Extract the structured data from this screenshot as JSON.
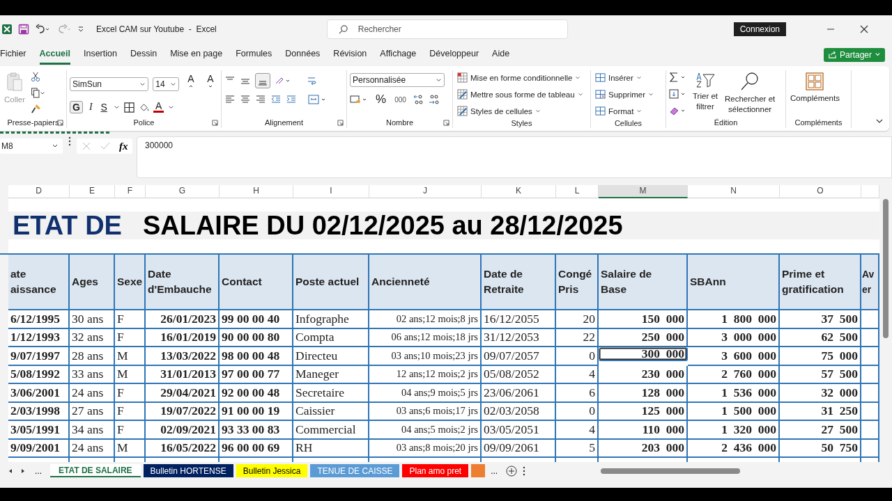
{
  "title_bar": {
    "document_title": "Excel CAM sur Youtube  -  Excel",
    "search_placeholder": "Rechercher",
    "signin_button": "Connexion",
    "share_button": "Partager"
  },
  "menu_tabs": [
    {
      "label": "Fichier",
      "selected": false
    },
    {
      "label": "Accueil",
      "selected": true
    },
    {
      "label": "Insertion",
      "selected": false
    },
    {
      "label": "Dessin",
      "selected": false
    },
    {
      "label": "Mise en page",
      "selected": false
    },
    {
      "label": "Formules",
      "selected": false
    },
    {
      "label": "Données",
      "selected": false
    },
    {
      "label": "Révision",
      "selected": false
    },
    {
      "label": "Affichage",
      "selected": false
    },
    {
      "label": "Développeur",
      "selected": false
    },
    {
      "label": "Aide",
      "selected": false
    }
  ],
  "ribbon": {
    "clipboard": {
      "paste": "Coller",
      "label": "Presse-papiers"
    },
    "font": {
      "name": "SimSun",
      "size": "14",
      "grow": "A",
      "shrink": "A",
      "bold": "G",
      "italic": "I",
      "underline": "S",
      "color_letter": "A",
      "label": "Police"
    },
    "alignment": {
      "label": "Alignement"
    },
    "number": {
      "format": "Personnalisée",
      "percent": "%",
      "thousands": "000",
      "label": "Nombre"
    },
    "styles": {
      "items": [
        "Mise en forme conditionnelle",
        "Mettre sous forme de tableau",
        "Styles de cellules"
      ],
      "label": "Styles"
    },
    "cells": {
      "items": [
        "Insérer",
        "Supprimer",
        "Format"
      ],
      "label": "Cellules"
    },
    "editing": {
      "sort": "Trier et\nfiltrer",
      "find": "Rechercher et\nsélectionner",
      "label": "Édition"
    },
    "addins": {
      "button": "Compléments",
      "label": "Compléments"
    }
  },
  "formula_bar": {
    "name_box": "M8",
    "fx": "fx",
    "value": "300000"
  },
  "sheet": {
    "columns": [
      {
        "letter": "D",
        "selected": false
      },
      {
        "letter": "E",
        "selected": false
      },
      {
        "letter": "F",
        "selected": false
      },
      {
        "letter": "G",
        "selected": false
      },
      {
        "letter": "H",
        "selected": false
      },
      {
        "letter": "I",
        "selected": false
      },
      {
        "letter": "J",
        "selected": false
      },
      {
        "letter": "K",
        "selected": false
      },
      {
        "letter": "L",
        "selected": false
      },
      {
        "letter": "M",
        "selected": true
      },
      {
        "letter": "N",
        "selected": false
      },
      {
        "letter": "O",
        "selected": false
      }
    ],
    "title_part_1": "ETAT DE",
    "title_part_2": "SALAIRE DU 02/12/2025 au 28/12/2025",
    "headers": [
      "ate\naissance",
      "Ages",
      "Sexe",
      "Date\nd'Embauche",
      "Contact",
      "Poste actuel",
      "Ancienneté",
      "Date de\nRetraite",
      "Congé\nPris",
      "Salaire de\nBase",
      "SBAnn",
      "Prime et\ngratification",
      "Av\ner"
    ],
    "rows": [
      {
        "selected": false,
        "cells": [
          "6/12/1995",
          "30 ans",
          "F",
          "26/01/2023",
          "99 00 00 40",
          "Infographe",
          "02 ans;12 mois;8 jrs",
          "16/12/2055",
          "20",
          "150  000",
          "1  800  000",
          "37  500"
        ]
      },
      {
        "selected": false,
        "cells": [
          "1/12/1993",
          "32 ans",
          "F",
          "16/01/2019",
          "90 00 00 80",
          "Compta",
          "06 ans;12 mois;18 jrs",
          "31/12/2053",
          "22",
          "250  000",
          "3  000  000",
          "62  500"
        ]
      },
      {
        "selected": true,
        "cells": [
          "9/07/1997",
          "28 ans",
          "M",
          "13/03/2022",
          "98 00 00 48",
          "Directeu",
          "03 ans;10 mois;23 jrs",
          "09/07/2057",
          "0",
          "300  000",
          "3  600  000",
          "75  000"
        ]
      },
      {
        "selected": false,
        "cells": [
          "5/08/1992",
          "33 ans",
          "M",
          "31/01/2013",
          "97 00 00 77",
          "Maneger",
          "12 ans;12 mois;2 jrs",
          "05/08/2052",
          "4",
          "230  000",
          "2  760  000",
          "57  500"
        ]
      },
      {
        "selected": false,
        "cells": [
          "3/06/2001",
          "24 ans",
          "F",
          "29/04/2021",
          "92 00 00 48",
          "Secretaire",
          "04 ans;9 mois;5 jrs",
          "23/06/2061",
          "6",
          "128  000",
          "1  536  000",
          "32  000"
        ]
      },
      {
        "selected": false,
        "cells": [
          "2/03/1998",
          "27 ans",
          "F",
          "19/07/2022",
          "91 00 00 19",
          "Caissier",
          "03 ans;6 mois;17 jrs",
          "02/03/2058",
          "0",
          "125  000",
          "1  500  000",
          "31  250"
        ]
      },
      {
        "selected": false,
        "cells": [
          "3/05/1991",
          "34 ans",
          "F",
          "02/09/2021",
          "93 33 00 83",
          "Commercial",
          "04 ans;5 mois;2 jrs",
          "03/05/2051",
          "4",
          "110  000",
          "1  320  000",
          "27  500"
        ]
      },
      {
        "selected": false,
        "cells": [
          "9/09/2001",
          "24 ans",
          "M",
          "16/05/2022",
          "96 00 00 69",
          "RH",
          "03 ans;8 mois;20 jrs",
          "09/09/2061",
          "5",
          "203  000",
          "2  436  000",
          "50  750"
        ]
      }
    ]
  },
  "sheet_tabs": {
    "more_left": "...",
    "more_right": "...",
    "tabs": [
      {
        "label": "ETAT DE SALAIRE",
        "selected": true,
        "color": "#ffffff"
      },
      {
        "label": "Bulletin HORTENSE",
        "selected": false,
        "color": "#002060"
      },
      {
        "label": "Bulletin Jessica",
        "selected": false,
        "color": "#ffff00"
      },
      {
        "label": "TENUE DE CAISSE",
        "selected": false,
        "color": "#5b9bd5"
      },
      {
        "label": "Plan amo pret",
        "selected": false,
        "color": "#ff0000"
      },
      {
        "selected": false,
        "color": "#ed7d31"
      }
    ]
  }
}
